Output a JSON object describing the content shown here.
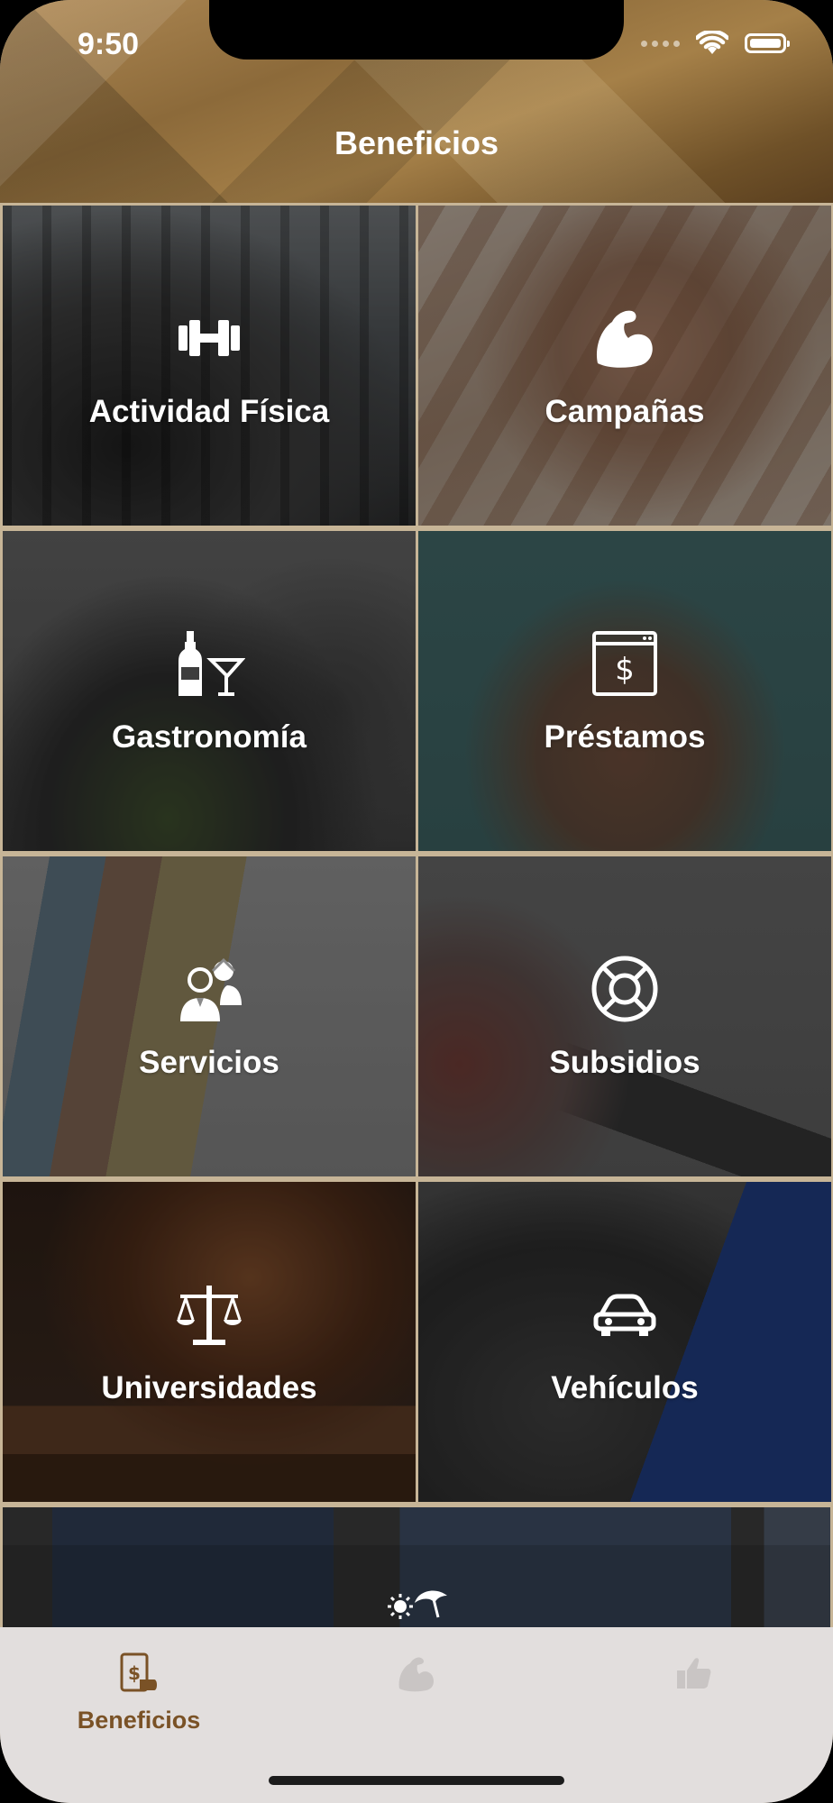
{
  "status_bar": {
    "time": "9:50"
  },
  "header": {
    "title": "Beneficios"
  },
  "tiles": [
    {
      "label": "Actividad Física",
      "icon": "dumbbell-icon"
    },
    {
      "label": "Campañas",
      "icon": "flexed-arm-icon"
    },
    {
      "label": "Gastronomía",
      "icon": "bottle-cocktail-icon"
    },
    {
      "label": "Préstamos",
      "icon": "dollar-document-icon"
    },
    {
      "label": "Servicios",
      "icon": "people-icon"
    },
    {
      "label": "Subsidios",
      "icon": "lifebuoy-icon"
    },
    {
      "label": "Universidades",
      "icon": "scales-icon"
    },
    {
      "label": "Vehículos",
      "icon": "car-icon"
    },
    {
      "label": "",
      "icon": "sun-umbrella-icon"
    }
  ],
  "tab_bar": {
    "tabs": [
      {
        "label": "Beneficios",
        "icon": "dollar-phone-icon",
        "active": true
      },
      {
        "label": "",
        "icon": "flexed-arm-icon",
        "active": false
      },
      {
        "label": "",
        "icon": "thumbs-up-icon",
        "active": false
      }
    ],
    "active_color": "#7a5226",
    "inactive_color": "#c9c5c4"
  },
  "colors": {
    "divider": "#c7b597",
    "header_brown": "#8c6a3a"
  }
}
